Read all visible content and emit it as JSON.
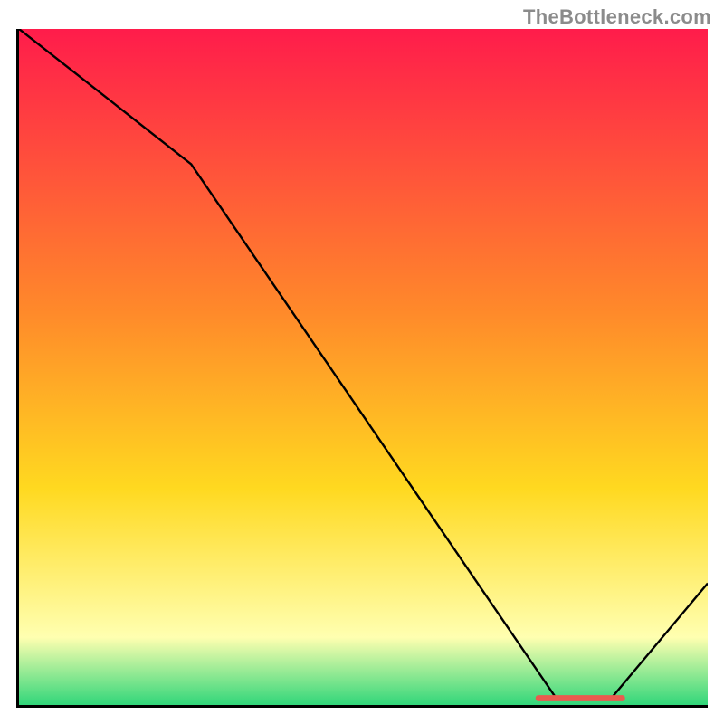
{
  "watermark": "TheBottleneck.com",
  "colors": {
    "gradient_top": "#ff1c4b",
    "gradient_mid1": "#ff8a2a",
    "gradient_mid2": "#ffd920",
    "gradient_low": "#ffffb0",
    "gradient_bottom": "#31d67a",
    "line": "#000000",
    "marker": "#e95b4f",
    "axis": "#000000"
  },
  "chart_data": {
    "type": "line",
    "title": "",
    "xlabel": "",
    "ylabel": "",
    "xlim": [
      0,
      100
    ],
    "ylim": [
      0,
      100
    ],
    "series": [
      {
        "name": "bottleneck-curve",
        "x": [
          0,
          25,
          78,
          86,
          100
        ],
        "y": [
          100,
          80,
          1,
          1,
          18
        ]
      }
    ],
    "annotations": [
      {
        "name": "optimal-marker",
        "x_start": 75,
        "x_end": 88,
        "y": 1
      }
    ]
  }
}
